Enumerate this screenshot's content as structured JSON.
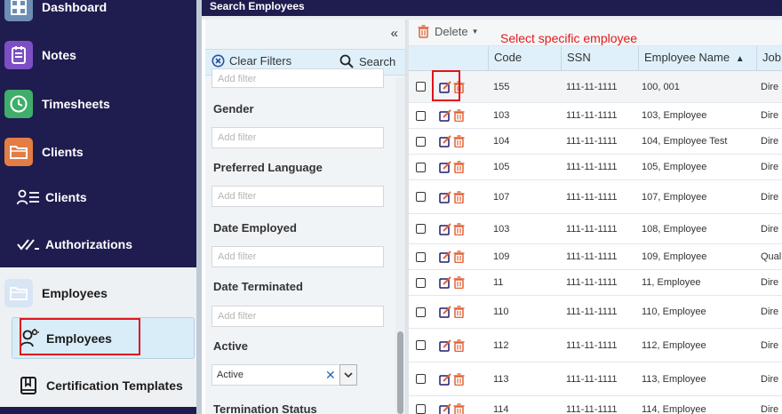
{
  "header": {
    "title": "Search Employees"
  },
  "sidebar": {
    "dashboard": "Dashboard",
    "notes": "Notes",
    "timesheets": "Timesheets",
    "clients_group": "Clients",
    "clients": "Clients",
    "authorizations": "Authorizations",
    "employees_group": "Employees",
    "employees": "Employees",
    "certification_templates": "Certification Templates"
  },
  "filters": {
    "clear_label": "Clear Filters",
    "search_label": "Search",
    "placeholder": "Add filter",
    "labels": {
      "gender": "Gender",
      "preferred_language": "Preferred Language",
      "date_employed": "Date Employed",
      "date_terminated": "Date Terminated",
      "active": "Active",
      "termination_status": "Termination Status"
    },
    "active_value": "Active"
  },
  "grid": {
    "delete_label": "Delete",
    "callout": "Select specific employee",
    "columns": {
      "code": "Code",
      "ssn": "SSN",
      "name": "Employee Name",
      "job": "Job"
    },
    "rows": [
      {
        "code": "155",
        "ssn": "111-11-1111",
        "name": "100, 001",
        "job": "Dire"
      },
      {
        "code": "103",
        "ssn": "111-11-1111",
        "name": "103, Employee",
        "job": "Dire"
      },
      {
        "code": "104",
        "ssn": "111-11-1111",
        "name": "104, Employee Test",
        "job": "Dire"
      },
      {
        "code": "105",
        "ssn": "111-11-1111",
        "name": "105, Employee",
        "job": "Dire"
      },
      {
        "code": "107",
        "ssn": "111-11-1111",
        "name": "107, Employee",
        "job": "Dire"
      },
      {
        "code": "103",
        "ssn": "111-11-1111",
        "name": "108, Employee",
        "job": "Dire"
      },
      {
        "code": "109",
        "ssn": "111-11-1111",
        "name": "109, Employee",
        "job": "Qual"
      },
      {
        "code": "11",
        "ssn": "111-11-1111",
        "name": "11, Employee",
        "job": "Dire"
      },
      {
        "code": "110",
        "ssn": "111-11-1111",
        "name": "110, Employee",
        "job": "Dire"
      },
      {
        "code": "112",
        "ssn": "111-11-1111",
        "name": "112, Employee",
        "job": "Dire"
      },
      {
        "code": "113",
        "ssn": "111-11-1111",
        "name": "113, Employee",
        "job": "Dire"
      },
      {
        "code": "114",
        "ssn": "111-11-1111",
        "name": "114, Employee",
        "job": "Dire"
      }
    ]
  },
  "colors": {
    "sidebar_bg": "#1f1c4f",
    "accent_light": "#dff0fa",
    "highlight": "#e0141b",
    "edit_icon": "#1f1c6b",
    "delete_icon": "#e0653a"
  },
  "icons": {
    "dashboard": "dashboard-icon",
    "notes": "notes-icon",
    "timesheets": "clock-icon",
    "clients_group": "folder-icon",
    "clients": "client-list-icon",
    "authorizations": "double-check-icon",
    "employees_group": "folder-icon",
    "employees": "user-gear-icon",
    "certification_templates": "bookmark-book-icon"
  }
}
